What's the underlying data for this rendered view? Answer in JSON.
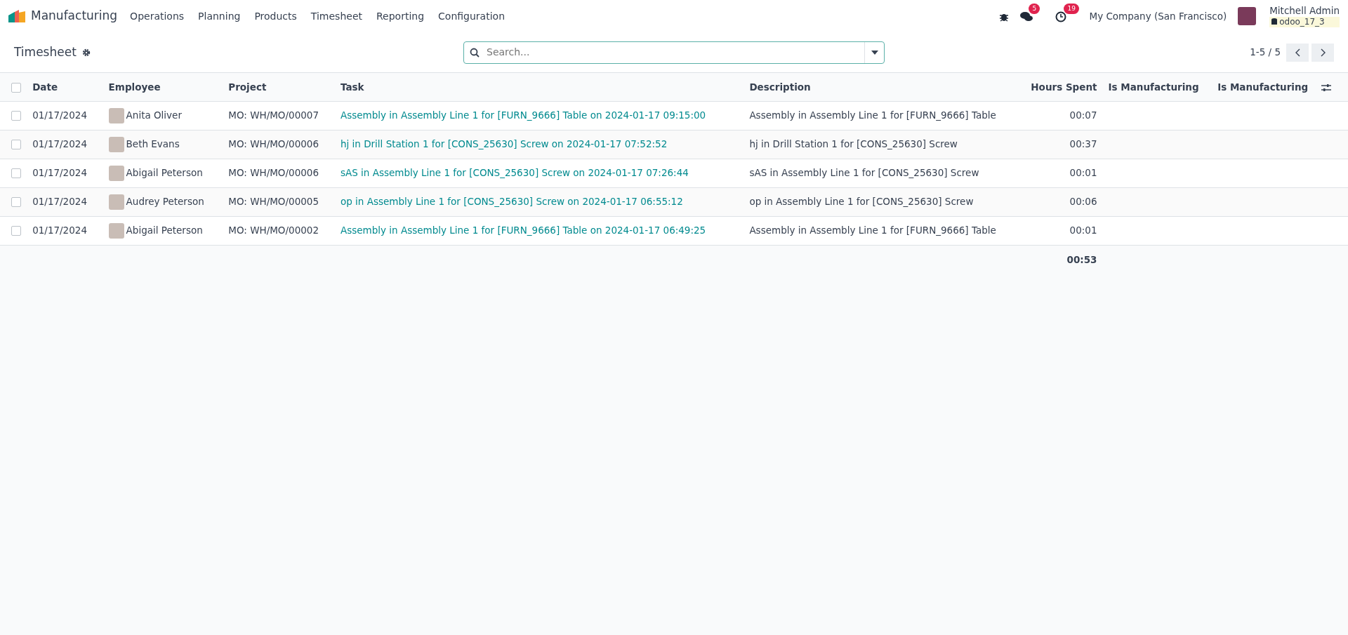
{
  "navbar": {
    "app_name": "Manufacturing",
    "menu": [
      "Operations",
      "Planning",
      "Products",
      "Timesheet",
      "Reporting",
      "Configuration"
    ],
    "messages_count": "5",
    "activities_count": "19",
    "company": "My Company (San Francisco)",
    "user": "Mitchell Admin",
    "database": "odoo_17_3"
  },
  "control_panel": {
    "title": "Timesheet",
    "search": {
      "placeholder": "Search..."
    },
    "pager": "1-5 / 5"
  },
  "table": {
    "select_all_checked": false,
    "columns": [
      "Date",
      "Employee",
      "Project",
      "Task",
      "Description",
      "Hours Spent",
      "Is Manufacturing",
      "Is Manufacturing"
    ],
    "rows": [
      {
        "checked": false,
        "date": "01/17/2024",
        "employee": "Anita Oliver",
        "project": "MO: WH/MO/00007",
        "task": "Assembly in Assembly Line 1 for [FURN_9666] Table on 2024-01-17 09:15:00",
        "description": "Assembly in Assembly Line 1 for [FURN_9666] Table",
        "hours": "00:07"
      },
      {
        "checked": false,
        "date": "01/17/2024",
        "employee": "Beth Evans",
        "project": "MO: WH/MO/00006",
        "task": "hj in Drill Station 1 for [CONS_25630] Screw on 2024-01-17 07:52:52",
        "description": "hj in Drill Station 1 for [CONS_25630] Screw",
        "hours": "00:37"
      },
      {
        "checked": false,
        "date": "01/17/2024",
        "employee": "Abigail Peterson",
        "project": "MO: WH/MO/00006",
        "task": "sAS in Assembly Line 1 for [CONS_25630] Screw on 2024-01-17 07:26:44",
        "description": "sAS in Assembly Line 1 for [CONS_25630] Screw",
        "hours": "00:01"
      },
      {
        "checked": false,
        "date": "01/17/2024",
        "employee": "Audrey Peterson",
        "project": "MO: WH/MO/00005",
        "task": "op in Assembly Line 1 for [CONS_25630] Screw on 2024-01-17 06:55:12",
        "description": "op in Assembly Line 1 for [CONS_25630] Screw",
        "hours": "00:06"
      },
      {
        "checked": false,
        "date": "01/17/2024",
        "employee": "Abigail Peterson",
        "project": "MO: WH/MO/00002",
        "task": "Assembly in Assembly Line 1 for [FURN_9666] Table on 2024-01-17 06:49:25",
        "description": "Assembly in Assembly Line 1 for [FURN_9666] Table",
        "hours": "00:01"
      }
    ],
    "total_hours": "00:53"
  }
}
